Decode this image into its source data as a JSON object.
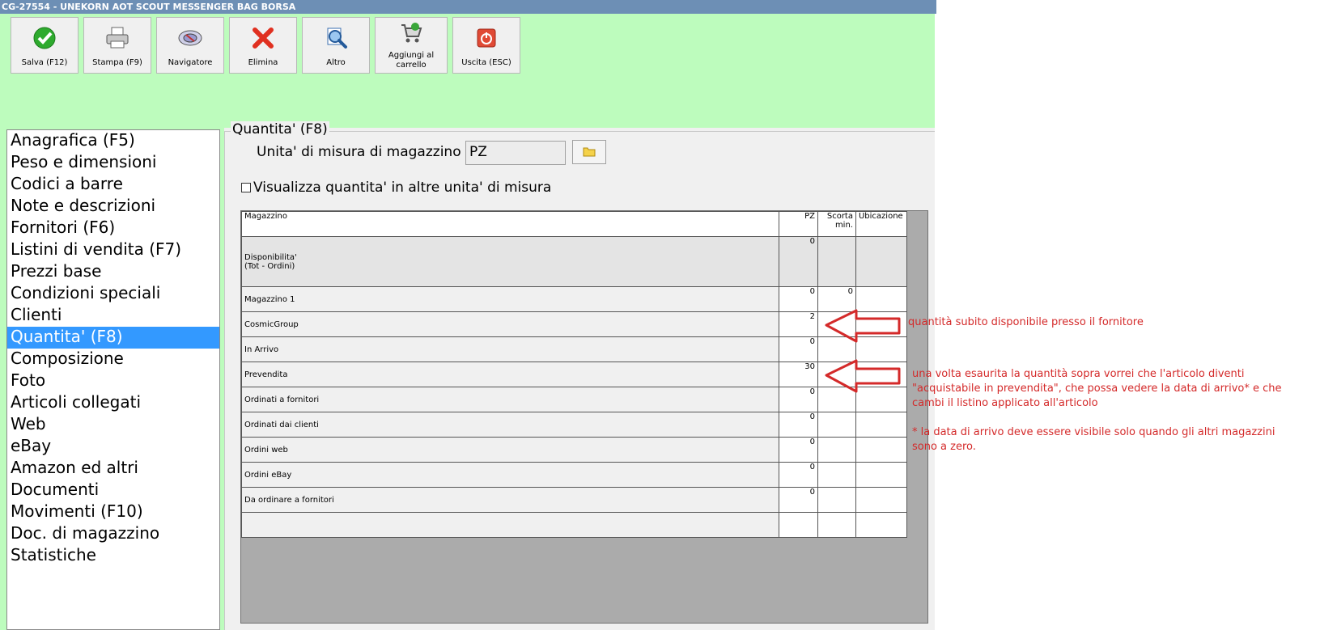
{
  "window": {
    "title": "CG-27554 -  UNEKORN AOT SCOUT MESSENGER BAG BORSA"
  },
  "toolbar": {
    "buttons": [
      {
        "label": "Salva (F12)",
        "icon": "check-icon"
      },
      {
        "label": "Stampa (F9)",
        "icon": "printer-icon"
      },
      {
        "label": "Navigatore",
        "icon": "navigator-icon"
      },
      {
        "label": "Elimina",
        "icon": "delete-x-icon"
      },
      {
        "label": "Altro",
        "icon": "magnifier-icon"
      },
      {
        "label": "Aggiungi al carrello",
        "icon": "cart-icon"
      },
      {
        "label": "Uscita (ESC)",
        "icon": "power-icon"
      }
    ]
  },
  "sidebar": {
    "items": [
      "Anagrafica (F5)",
      "Peso e dimensioni",
      "Codici a barre",
      "Note e descrizioni",
      "Fornitori (F6)",
      "Listini di vendita (F7)",
      "Prezzi base",
      "Condizioni speciali",
      "Clienti",
      "Quantita' (F8)",
      "Composizione",
      "Foto",
      "Articoli collegati",
      "Web",
      "eBay",
      "Amazon ed altri",
      "Documenti",
      "Movimenti (F10)",
      "Doc. di magazzino",
      "Statistiche"
    ],
    "selected": "Quantita' (F8)"
  },
  "panel": {
    "title": "Quantita' (F8)",
    "uom_label": "Unita' di misura di magazzino :",
    "uom_value": "PZ",
    "checkbox_label": "Visualizza quantita' in altre unita' di misura",
    "checkbox_checked": false
  },
  "grid": {
    "headers": {
      "name": "Magazzino",
      "pz": "PZ",
      "scorta": "Scorta min.",
      "ubicazione": "Ubicazione"
    },
    "availability": {
      "name": "Disponibilita'\n (Tot - Ordini)",
      "pz": "0"
    },
    "rows": [
      {
        "name": "Magazzino 1",
        "pz": "0",
        "scorta": "0"
      },
      {
        "name": "CosmicGroup",
        "pz": "2",
        "scorta": ""
      },
      {
        "name": "In Arrivo",
        "pz": "0",
        "scorta": ""
      },
      {
        "name": "Prevendita",
        "pz": "30",
        "scorta": ""
      },
      {
        "name": "Ordinati a fornitori",
        "pz": "0",
        "scorta": ""
      },
      {
        "name": "Ordinati dai clienti",
        "pz": "0",
        "scorta": ""
      },
      {
        "name": "Ordini web",
        "pz": "0",
        "scorta": ""
      },
      {
        "name": "Ordini eBay",
        "pz": "0",
        "scorta": ""
      },
      {
        "name": "Da ordinare a fornitori",
        "pz": "0",
        "scorta": ""
      }
    ]
  },
  "annotations": {
    "note1": "quantità subito disponibile presso il fornitore",
    "note2": "una volta esaurita la quantità sopra vorrei che l'articolo diventi \"acquistabile in prevendita\", che possa vedere la data di arrivo* e che cambi il listino applicato all'articolo",
    "note3": "* la data di arrivo deve essere visibile solo quando gli altri magazzini sono a zero.",
    "arrow_color": "#d42a2a"
  },
  "colors": {
    "app_bg": "#bdfcbd",
    "selection": "#3399ff",
    "titlebar": "#6d8fb5"
  }
}
